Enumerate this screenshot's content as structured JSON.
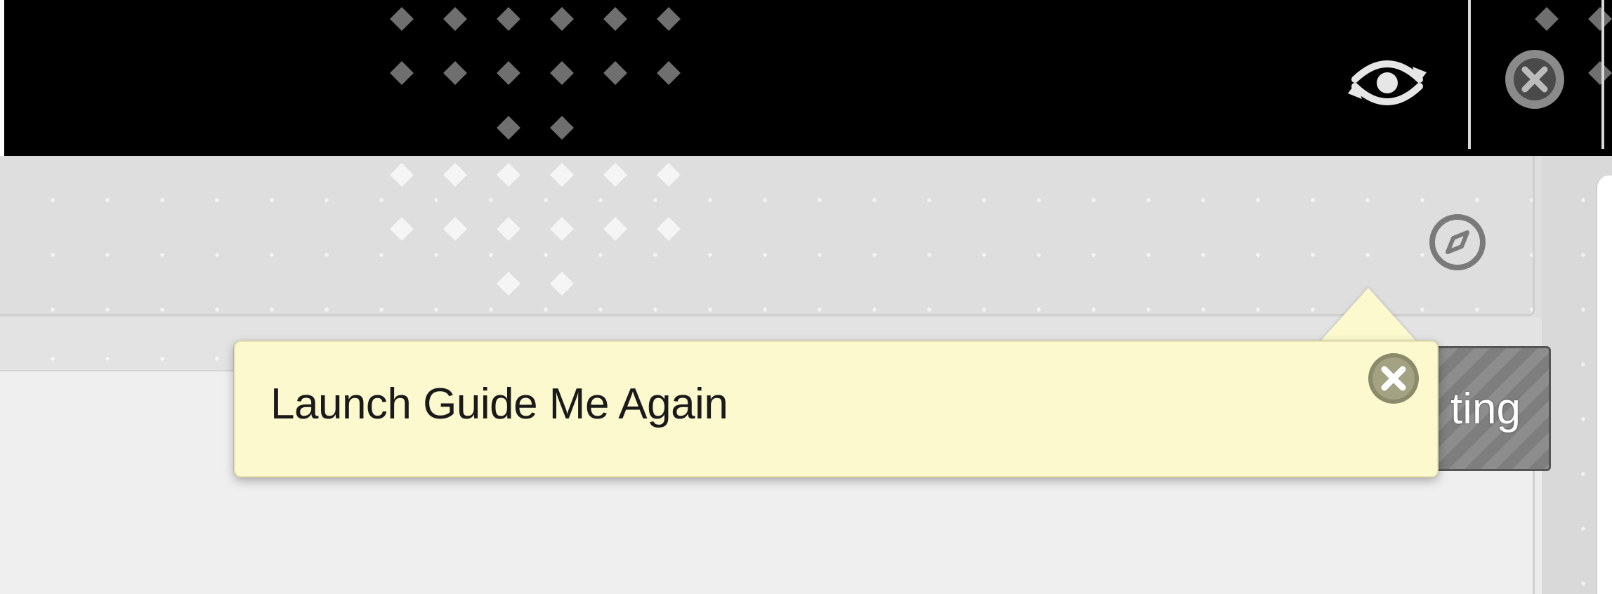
{
  "header": {
    "switch_view_icon": "eye-refresh-icon",
    "profile_icon": "user-avatar-icon"
  },
  "toolbar": {
    "compass_icon": "compass-icon",
    "partial_button_label": "ting"
  },
  "guide_tooltip": {
    "text": "Launch Guide Me Again",
    "close_icon": "close-icon"
  },
  "colors": {
    "header_bg": "#000000",
    "tooltip_bg": "#fcf9cf",
    "content_bg": "#efefef",
    "button_grey": "#8d8d8d"
  }
}
